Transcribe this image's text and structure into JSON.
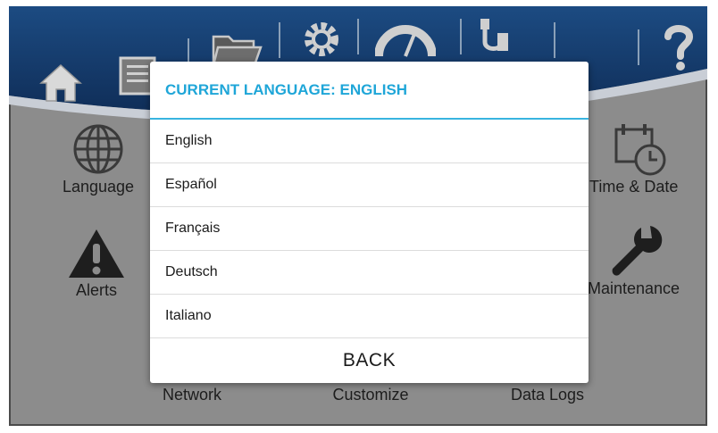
{
  "dialog": {
    "title": "CURRENT LANGUAGE: ENGLISH",
    "options": [
      "English",
      "Español",
      "Français",
      "Deutsch",
      "Italiano"
    ],
    "back_label": "BACK",
    "accent_color": "#1fa6d8"
  },
  "menu": {
    "language": "Language",
    "time_date": "Time & Date",
    "alerts": "Alerts",
    "maintenance": "Maintenance",
    "network": "Network",
    "customize": "Customize",
    "data_logs": "Data Logs"
  },
  "toolbar": {
    "icons": [
      "home-icon",
      "report-icon",
      "folder-icon",
      "settings-icon",
      "gauge-icon",
      "usb-icon",
      "help-icon"
    ]
  },
  "colors": {
    "header_blue": "#143a6b",
    "background_gray": "#8c8c8c"
  }
}
